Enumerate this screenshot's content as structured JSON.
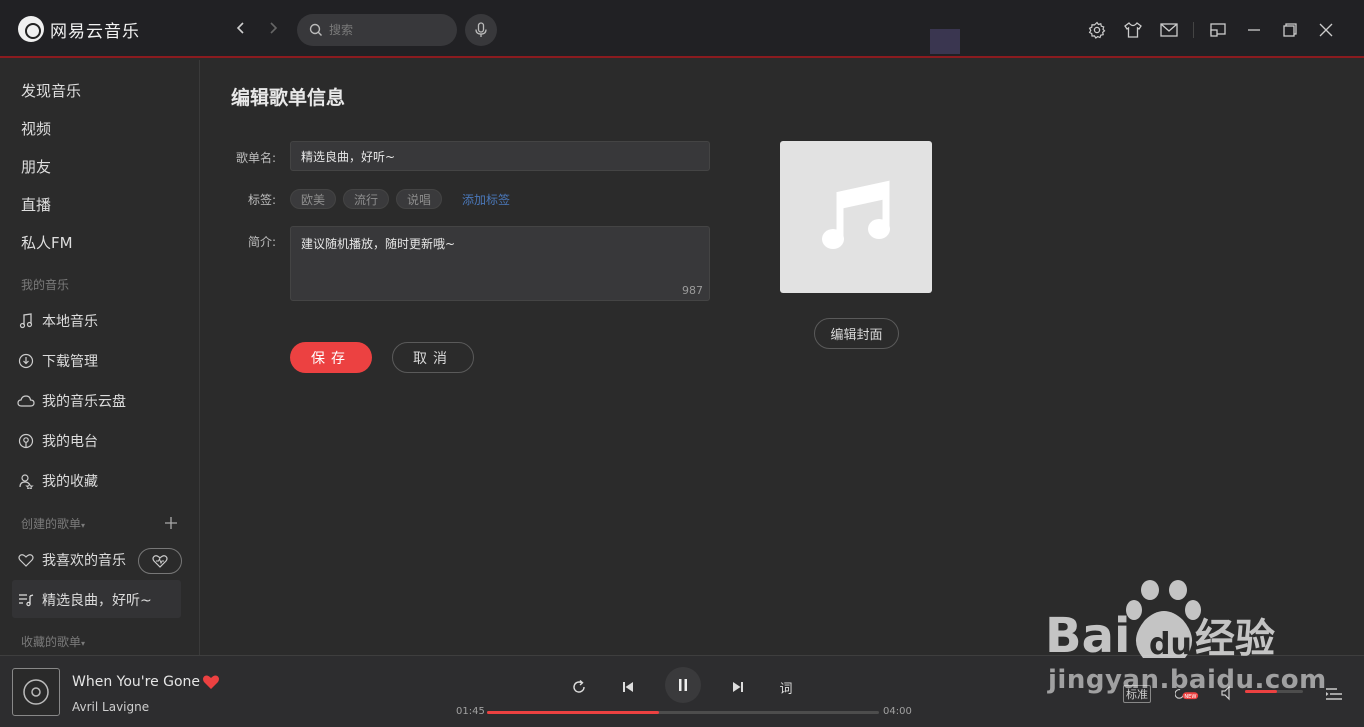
{
  "app": {
    "name": "网易云音乐"
  },
  "search": {
    "placeholder": "搜索"
  },
  "sidebar": {
    "main_items": [
      "发现音乐",
      "视频",
      "朋友",
      "直播",
      "私人FM"
    ],
    "my_music_header": "我的音乐",
    "my_music_items": [
      {
        "label": "本地音乐",
        "icon": "music-note-icon"
      },
      {
        "label": "下载管理",
        "icon": "download-icon"
      },
      {
        "label": "我的音乐云盘",
        "icon": "cloud-icon"
      },
      {
        "label": "我的电台",
        "icon": "radio-icon"
      },
      {
        "label": "我的收藏",
        "icon": "collection-icon"
      }
    ],
    "created_header": "创建的歌单",
    "created_items": [
      {
        "label": "我喜欢的音乐",
        "icon": "heart-icon"
      },
      {
        "label": "精选良曲，好听~",
        "icon": "playlist-icon"
      }
    ],
    "collected_header": "收藏的歌单"
  },
  "editor": {
    "title": "编辑歌单信息",
    "name_label": "歌单名:",
    "name_value": "精选良曲，好听~",
    "tags_label": "标签:",
    "tags": [
      "欧美",
      "流行",
      "说唱"
    ],
    "add_tag": "添加标签",
    "desc_label": "简介:",
    "desc_value": "建议随机播放，随时更新哦~",
    "desc_remaining": "987",
    "save": "保存",
    "cancel": "取消",
    "edit_cover": "编辑封面"
  },
  "player": {
    "song": "When You're Gone",
    "artist": "Avril Lavigne",
    "current_time": "01:45",
    "total_time": "04:00",
    "progress": 0.44,
    "lyrics": "词",
    "quality": "标准",
    "volume": 0.55,
    "new_badge": "NEW"
  },
  "watermark": {
    "text": "jingyan.baidu.com"
  },
  "colors": {
    "accent": "#ec4141",
    "link": "#4a77b8"
  }
}
